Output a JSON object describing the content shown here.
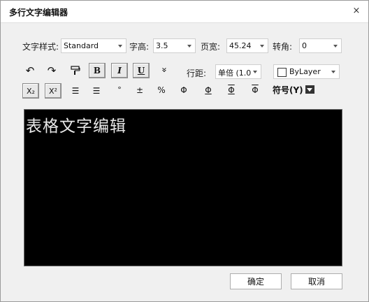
{
  "window": {
    "title": "多行文字编辑器",
    "close_glyph": "×"
  },
  "format": {
    "style_label": "文字样式:",
    "style_value": "Standard",
    "height_label": "字高:",
    "height_value": "3.5",
    "width_label": "页宽:",
    "width_value": "45.24",
    "rotation_label": "转角:",
    "rotation_value": "0"
  },
  "toolbar": {
    "undo_glyph": "↶",
    "redo_glyph": "↷",
    "bold_glyph": "B",
    "italic_glyph": "I",
    "underline_glyph": "U",
    "more_glyph": "»",
    "linespacing_label": "行距:",
    "linespacing_value": "单倍 (1.0",
    "color_value": "ByLayer",
    "subscript_glyph": "X₂",
    "superscript_glyph": "X²",
    "list_numbered_glyph": "☰",
    "list_glyph": "☰",
    "degree_glyph": "°",
    "plusminus_glyph": "±",
    "percent_glyph": "%",
    "diameter1_glyph": "Φ",
    "diameter2_glyph": "Φ",
    "diameter3_glyph": "Φ",
    "diameter4_glyph": "Φ",
    "symbol_label": "符号(Y)"
  },
  "editor": {
    "content": "表格文字编辑"
  },
  "actions": {
    "ok_label": "确定",
    "cancel_label": "取消"
  }
}
